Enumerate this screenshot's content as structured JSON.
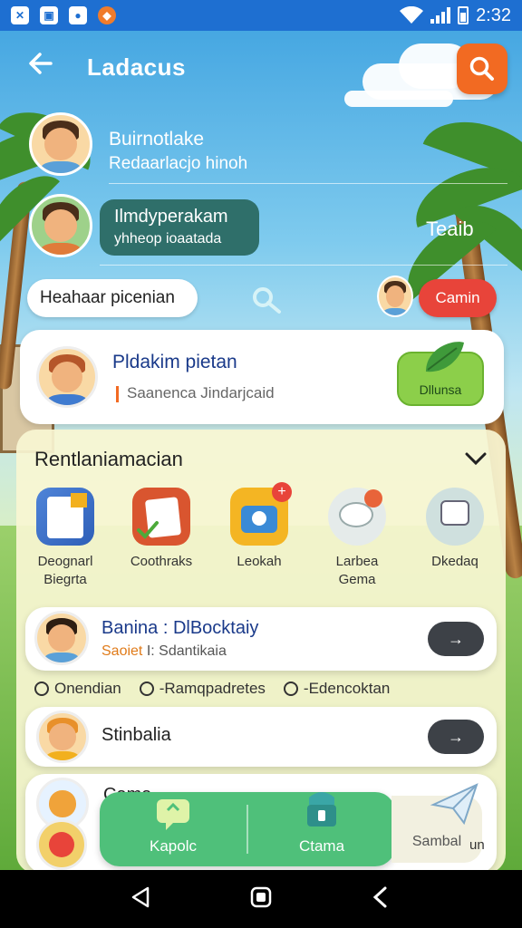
{
  "status": {
    "time": "2:32",
    "battery": "7"
  },
  "header": {
    "title": "Ladacus",
    "back_icon": "arrow-left-icon",
    "search_icon": "search-icon"
  },
  "profile1": {
    "name": "Buirnotlake",
    "subtitle": "Redaarlacjo hinoh"
  },
  "profile2": {
    "name": "Ilmdyperakam",
    "subtitle": "yhheop ioaatada"
  },
  "side_label": "Teaib",
  "chip_left": "Heahaar picenian",
  "chip_right": "Camin",
  "feature_card": {
    "title": "Pldakim pietan",
    "subtitle": "Saanenca Jindarjcaid",
    "badge": "Dllunsa"
  },
  "section": {
    "title": "Rentlaniamacian"
  },
  "apps": [
    {
      "label1": "Deognarl",
      "label2": "Biegrta"
    },
    {
      "label1": "Coothraks",
      "label2": ""
    },
    {
      "label1": "Leokah",
      "label2": ""
    },
    {
      "label1": "Larbea",
      "label2": "Gema"
    },
    {
      "label1": "Dkedaq",
      "label2": ""
    }
  ],
  "row1": {
    "title": "Banina : DlBocktaiy",
    "subtitle_accent": "Saoiet",
    "subtitle": "I: Sdantikaia",
    "button": "→"
  },
  "tags": [
    "Onendian",
    "-Ramqpadretes",
    "-Edencoktan"
  ],
  "row2": {
    "title": "Stinbalia",
    "button": "→"
  },
  "row3": {
    "title": "Cama"
  },
  "bottom_nav": [
    {
      "label": "Kapolc"
    },
    {
      "label": "Ctama"
    },
    {
      "label": "Sambal"
    }
  ],
  "bottom_extra": "un",
  "colors": {
    "accent": "#f26a22",
    "status_bar": "#1e6fd1",
    "green": "#4fc07a",
    "red": "#e8443a"
  }
}
